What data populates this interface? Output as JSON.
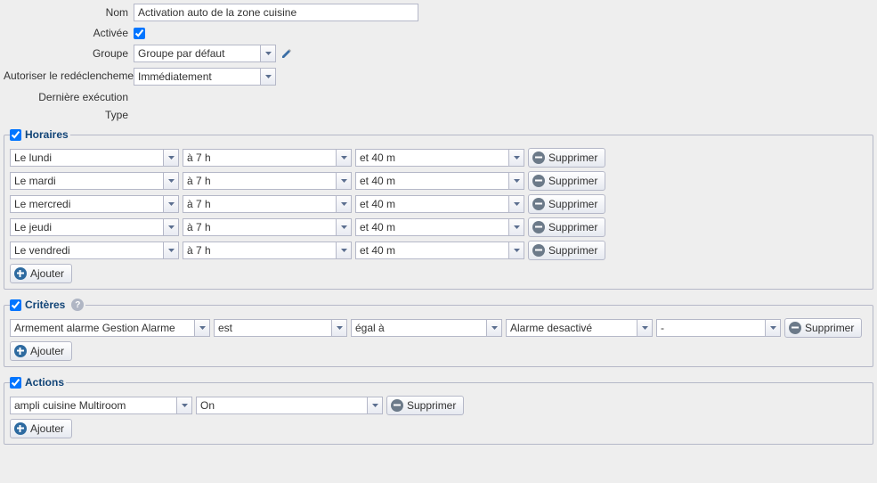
{
  "form": {
    "name_label": "Nom",
    "name_value": "Activation auto de la zone cuisine",
    "active_label": "Activée",
    "active_checked": true,
    "group_label": "Groupe",
    "group_value": "Groupe par défaut",
    "retrigger_label": "Autoriser le redéclenchement",
    "retrigger_value": "Immédiatement",
    "last_exec_label": "Dernière exécution",
    "last_exec_value": "",
    "type_label": "Type",
    "type_value": ""
  },
  "sections": {
    "schedules": {
      "title": "Horaires",
      "enabled": true,
      "rows": [
        {
          "day": "Le lundi",
          "hour": "à 7 h",
          "minute": "et 40 m"
        },
        {
          "day": "Le mardi",
          "hour": "à 7 h",
          "minute": "et 40 m"
        },
        {
          "day": "Le mercredi",
          "hour": "à 7 h",
          "minute": "et 40 m"
        },
        {
          "day": "Le jeudi",
          "hour": "à 7 h",
          "minute": "et 40 m"
        },
        {
          "day": "Le vendredi",
          "hour": "à 7 h",
          "minute": "et 40 m"
        }
      ]
    },
    "criteria": {
      "title": "Critères",
      "enabled": true,
      "rows": [
        {
          "field": "Armement alarme Gestion Alarme",
          "verb": "est",
          "op": "égal à",
          "value": "Alarme desactivé",
          "extra": "-"
        }
      ]
    },
    "actions": {
      "title": "Actions",
      "enabled": true,
      "rows": [
        {
          "target": "ampli cuisine Multiroom",
          "value": "On"
        }
      ]
    }
  },
  "buttons": {
    "add": "Ajouter",
    "delete": "Supprimer"
  }
}
